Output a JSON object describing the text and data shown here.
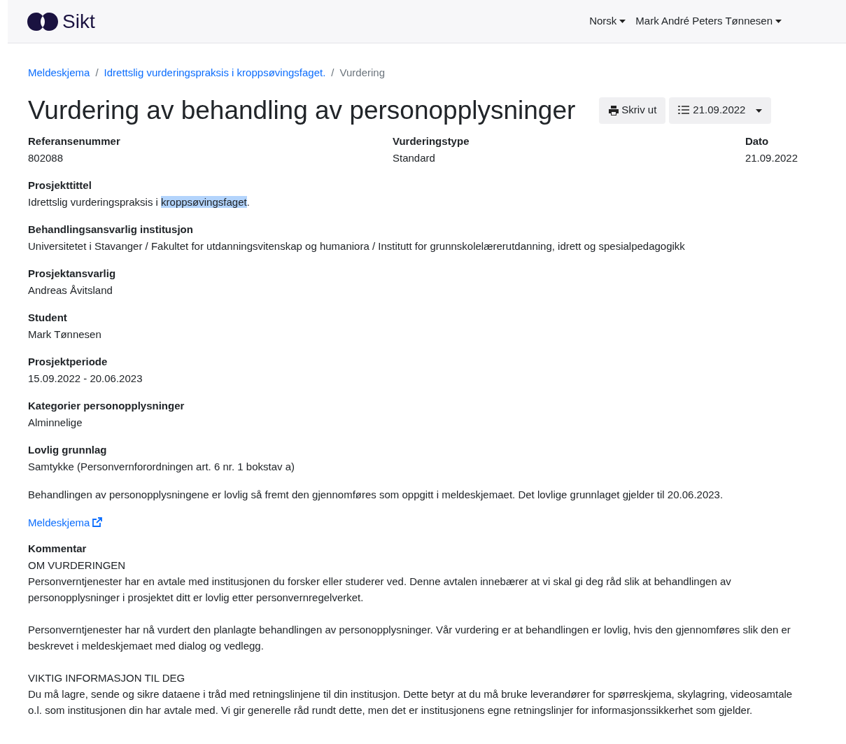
{
  "header": {
    "logo_text": "Sikt",
    "menus": [
      {
        "label": "Norsk"
      },
      {
        "label": "Mark André Peters Tønnesen"
      }
    ]
  },
  "breadcrumb": [
    {
      "label": "Meldeskjema",
      "link": true
    },
    {
      "separator": "/",
      "label": "Idrettslig vurderingspraksis i kroppsøvingsfaget.",
      "link": true
    },
    {
      "separator": "/",
      "label": "Vurdering",
      "link": false
    }
  ],
  "title": "Vurdering av behandling av personopplysninger",
  "print_button": "Skriv ut",
  "version_button": "21.09.2022",
  "summary": [
    {
      "label": "Referansenummer",
      "value": "802088"
    },
    {
      "label": "Vurderingstype",
      "value": "Standard"
    },
    {
      "label": "Dato",
      "value": "21.09.2022"
    }
  ],
  "fields": [
    {
      "label": "Prosjekttittel",
      "value_parts": [
        {
          "text": "Idrettslig vurderingspraksis i ",
          "selected": false
        },
        {
          "text": "kroppsøvingsfaget",
          "selected": true
        },
        {
          "text": ".",
          "selected": false
        }
      ]
    },
    {
      "label": "Behandlingsansvarlig institusjon",
      "value_parts": [
        {
          "text": "Universitetet i Stavanger / Fakultet for utdanningsvitenskap og humaniora / Institutt for grunnskolelærerutdanning, idrett og spesialpedagogikk",
          "selected": false
        }
      ]
    },
    {
      "label": "Prosjektansvarlig",
      "value_parts": [
        {
          "text": "Andreas Åvitsland",
          "selected": false
        }
      ]
    },
    {
      "label": "Student",
      "value_parts": [
        {
          "text": "Mark Tønnesen",
          "selected": false
        }
      ]
    },
    {
      "label": "Prosjektperiode",
      "value_parts": [
        {
          "text": "15.09.2022 - 20.06.2023",
          "selected": false
        }
      ]
    },
    {
      "label": "Kategorier personopplysninger",
      "value_parts": [
        {
          "text": "Alminnelige",
          "selected": false
        }
      ]
    },
    {
      "label": "Lovlig grunnlag",
      "value_parts": [
        {
          "text": "Samtykke (Personvernforordningen art. 6 nr. 1 bokstav a)",
          "selected": false
        }
      ]
    }
  ],
  "statement": "Behandlingen av personopplysningene er lovlig så fremt den gjennomføres som oppgitt i meldeskjemaet. Det lovlige grunnlaget gjelder til 20.06.2023.",
  "form_link": "Meldeskjema",
  "comment": {
    "label": "Kommentar",
    "blocks": [
      {
        "kind": "heading",
        "text": "OM VURDERINGEN"
      },
      {
        "kind": "paragraph",
        "text": "Personverntjenester har en avtale med institusjonen du forsker eller studerer ved. Denne avtalen innebærer at vi skal gi deg råd slik at behandlingen av personopplysninger i prosjektet ditt er lovlig etter personvernregelverket."
      },
      {
        "kind": "paragraph",
        "text": "Personverntjenester har nå vurdert den planlagte behandlingen av personopplysninger. Vår vurdering er at behandlingen er lovlig, hvis den gjennomføres slik den er beskrevet i meldeskjemaet med dialog og vedlegg."
      },
      {
        "kind": "heading",
        "text": "VIKTIG INFORMASJON TIL DEG"
      },
      {
        "kind": "paragraph",
        "text": "Du må lagre, sende og sikre dataene i tråd med retningslinjene til din institusjon. Dette betyr at du må bruke leverandører for spørreskjema, skylagring, videosamtale o.l. som institusjonen din har avtale med. Vi gir generelle råd rundt dette, men det er institusjonens egne retningslinjer for informasjonssikkerhet som gjelder."
      }
    ]
  }
}
